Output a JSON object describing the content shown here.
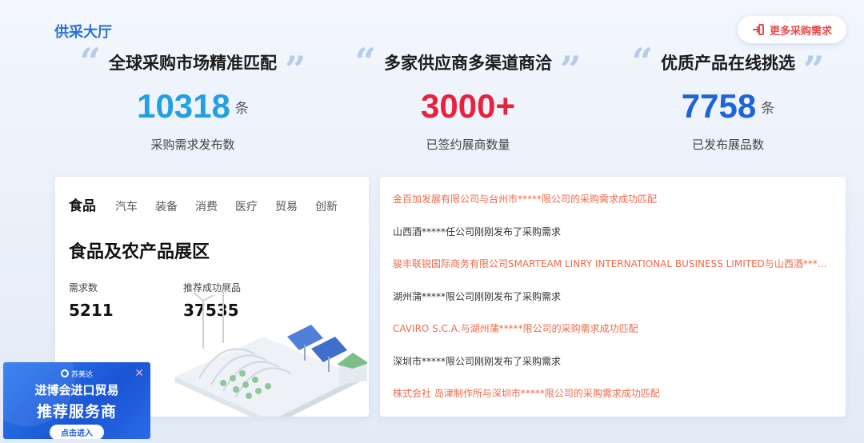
{
  "header": {
    "title": "供采大厅",
    "more_button": "更多采购需求"
  },
  "stats": [
    {
      "title": "全球采购市场精准匹配",
      "value": "10318",
      "unit": "条",
      "caption": "采购需求发布数",
      "color": "#23a0e2"
    },
    {
      "title": "多家供应商多渠道商洽",
      "value": "3000+",
      "unit": "",
      "caption": "已签约展商数量",
      "color": "#e8223c"
    },
    {
      "title": "优质产品在线挑选",
      "value": "7758",
      "unit": "条",
      "caption": "已发布展品数",
      "color": "#1e63d8"
    }
  ],
  "tabs": [
    "食品",
    "汽车",
    "装备",
    "消费",
    "医疗",
    "贸易",
    "创新"
  ],
  "zone": {
    "title": "食品及农产品展区",
    "demand_label": "需求数",
    "demand_value": "5211",
    "matched_label": "推荐成功展品",
    "matched_value": "37535"
  },
  "feed": [
    {
      "text": "金百加发展有限公司与台州市*****限公司的采购需求成功匹配",
      "type": "match"
    },
    {
      "text": "山西酒*****任公司刚刚发布了采购需求",
      "type": "post"
    },
    {
      "text": "骏丰联锐国际商务有限公司SMARTEAM LINRY INTERNATIONAL BUSINESS LIMITED与山西酒*****任公司的采购需求成功匹配",
      "type": "match"
    },
    {
      "text": "湖州蒲*****限公司刚刚发布了采购需求",
      "type": "post"
    },
    {
      "text": "CAVIRO S.C.A.与湖州蒲*****限公司的采购需求成功匹配",
      "type": "match"
    },
    {
      "text": "深圳市*****限公司刚刚发布了采购需求",
      "type": "post"
    },
    {
      "text": "株式会社 岛津制作所与深圳市*****限公司的采购需求成功匹配",
      "type": "match"
    }
  ],
  "ad": {
    "logo": "苏美达",
    "line1": "进博会进口贸易",
    "line2": "推荐服务商",
    "button": "点击进入",
    "close": "✕"
  },
  "icons": [
    "login-arrow-icon",
    "open-quote-icon",
    "close-quote-icon",
    "greenhouse-illustration",
    "close-icon"
  ]
}
